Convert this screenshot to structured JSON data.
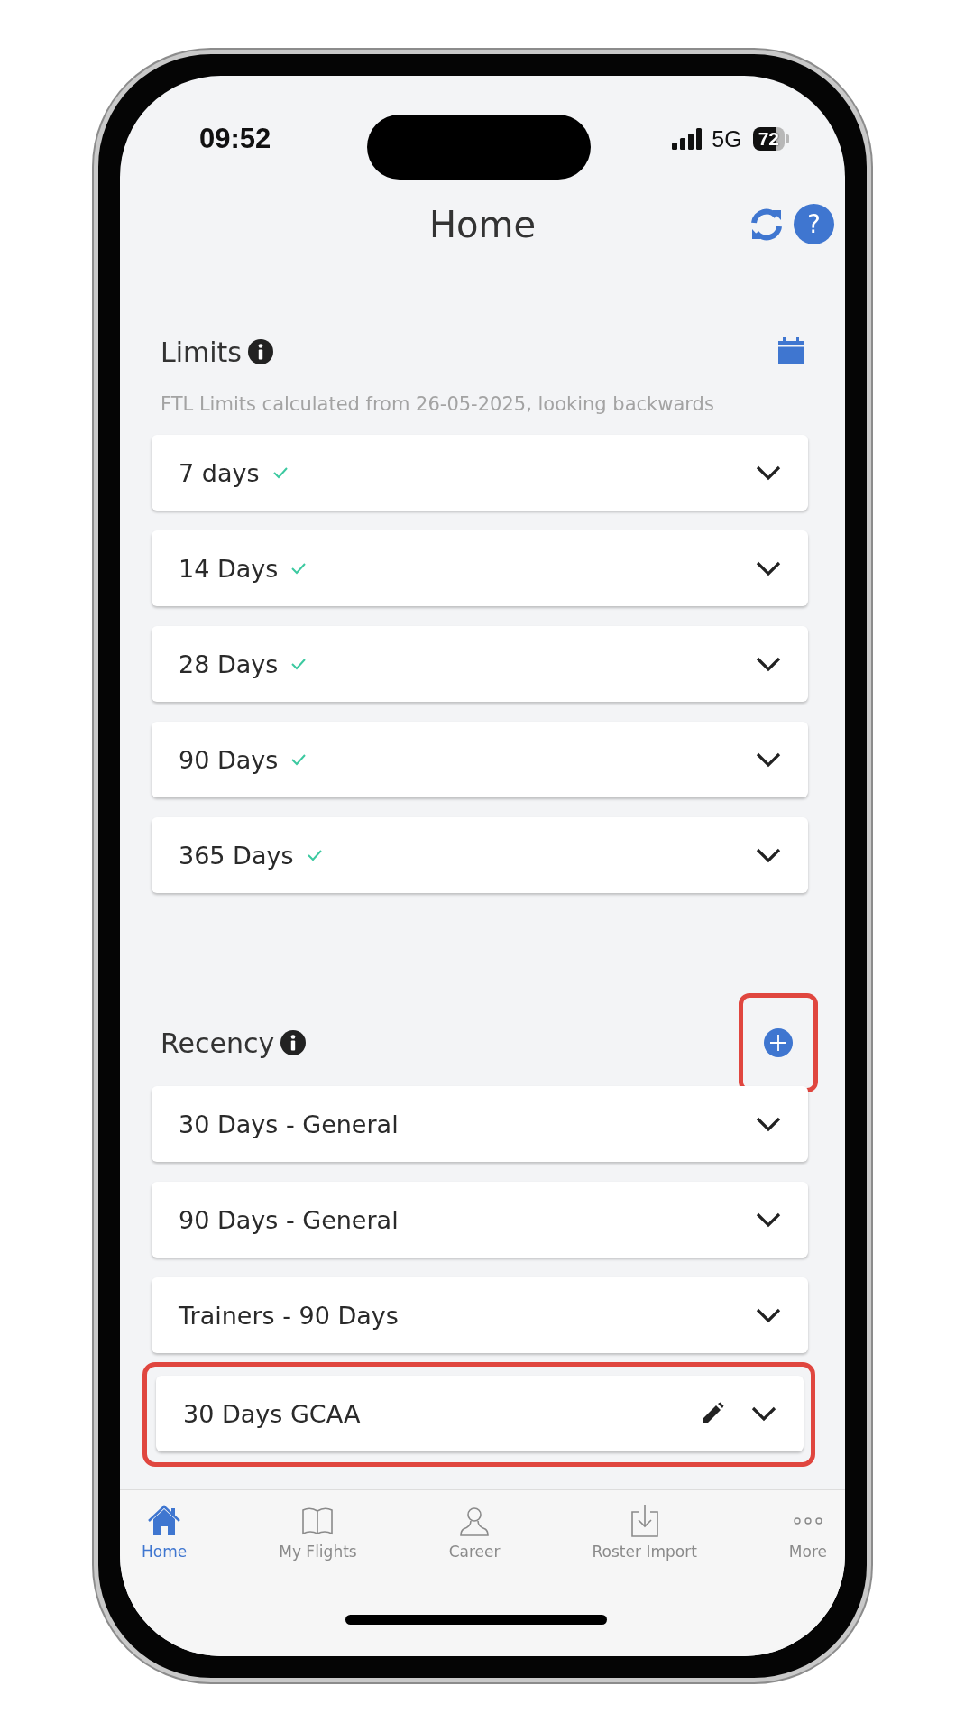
{
  "status_bar": {
    "time": "09:52",
    "network": "5G",
    "battery": "72"
  },
  "header": {
    "title": "Home",
    "help": "?"
  },
  "limits": {
    "title": "Limits",
    "subtitle": "FTL Limits calculated from 26-05-2025, looking backwards",
    "items": [
      {
        "label": "7 days",
        "ok": true
      },
      {
        "label": "14 Days",
        "ok": true
      },
      {
        "label": "28 Days",
        "ok": true
      },
      {
        "label": "90 Days",
        "ok": true
      },
      {
        "label": "365 Days",
        "ok": true
      }
    ]
  },
  "recency": {
    "title": "Recency",
    "add_highlighted": true,
    "items": [
      {
        "label": "30 Days - General",
        "editable": false,
        "highlighted": false
      },
      {
        "label": "90 Days - General",
        "editable": false,
        "highlighted": false
      },
      {
        "label": "Trainers - 90 Days",
        "editable": false,
        "highlighted": false
      },
      {
        "label": "30 Days GCAA",
        "editable": true,
        "highlighted": true
      }
    ]
  },
  "tab_bar": [
    {
      "label": "Home",
      "kind": "home",
      "selected": true
    },
    {
      "label": "My Flights",
      "kind": "book",
      "selected": false
    },
    {
      "label": "Career",
      "kind": "person",
      "selected": false
    },
    {
      "label": "Roster Import",
      "kind": "import",
      "selected": false
    },
    {
      "label": "More",
      "kind": "more",
      "selected": false
    }
  ]
}
